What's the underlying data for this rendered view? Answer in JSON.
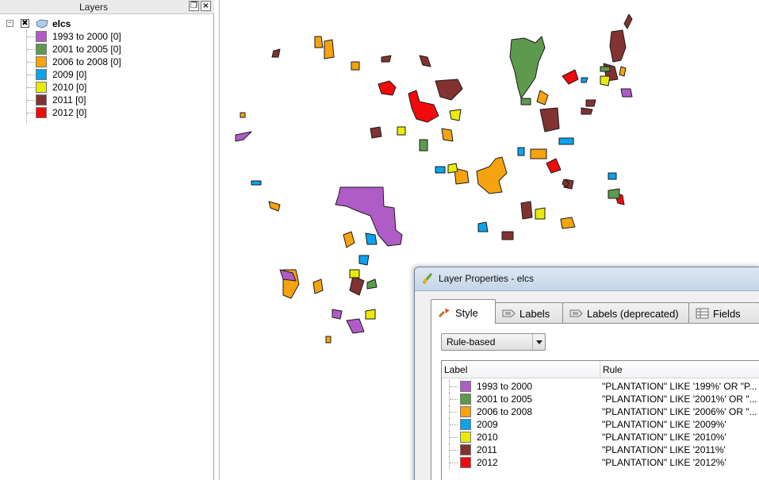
{
  "layers_panel": {
    "title": "Layers",
    "float_icon": "restore-icon",
    "close_icon": "close-icon",
    "layer": {
      "name": "elcs",
      "expander": "−",
      "check_mark": "✖",
      "legend": [
        {
          "label": "1993 to 2000 [0]",
          "color": "#b05cc6"
        },
        {
          "label": "2001 to 2005 [0]",
          "color": "#5e9a4d"
        },
        {
          "label": "2006 to 2008 [0]",
          "color": "#f5a30f"
        },
        {
          "label": "2009 [0]",
          "color": "#0ba3ec"
        },
        {
          "label": "2010 [0]",
          "color": "#eaea0a"
        },
        {
          "label": "2011 [0]",
          "color": "#833232"
        },
        {
          "label": "2012 [0]",
          "color": "#f20a0a"
        }
      ]
    }
  },
  "dialog": {
    "title": "Layer Properties - elcs",
    "tabs": [
      {
        "label": "Style",
        "icon": "paintbrush-icon",
        "active": true
      },
      {
        "label": "Labels",
        "icon": "labels-icon",
        "active": false
      },
      {
        "label": "Labels (deprecated)",
        "icon": "labels-deprecated-icon",
        "active": false
      },
      {
        "label": "Fields",
        "icon": "fields-table-icon",
        "active": false
      }
    ],
    "renderer_select": {
      "value": "Rule-based"
    },
    "table": {
      "headers": {
        "label": "Label",
        "rule": "Rule"
      },
      "rows": [
        {
          "label": "1993 to 2000",
          "rule": "\"PLANTATION\" LIKE '199%' OR \"P...",
          "color": "#b05cc6"
        },
        {
          "label": "2001 to 2005",
          "rule": "\"PLANTATION\" LIKE '2001%' OR  \"...",
          "color": "#5e9a4d"
        },
        {
          "label": "2006 to 2008",
          "rule": "\"PLANTATION\" LIKE '2006%' OR  \"...",
          "color": "#f5a30f"
        },
        {
          "label": "2009",
          "rule": "\"PLANTATION\" LIKE '2009%'",
          "color": "#0ba3ec"
        },
        {
          "label": "2010",
          "rule": "\"PLANTATION\" LIKE '2010%'",
          "color": "#eaea0a"
        },
        {
          "label": "2011",
          "rule": "\"PLANTATION\" LIKE '2011%'",
          "color": "#833232"
        },
        {
          "label": "2012",
          "rule": "\"PLANTATION\" LIKE '2012%'",
          "color": "#f20a0a"
        }
      ]
    }
  }
}
